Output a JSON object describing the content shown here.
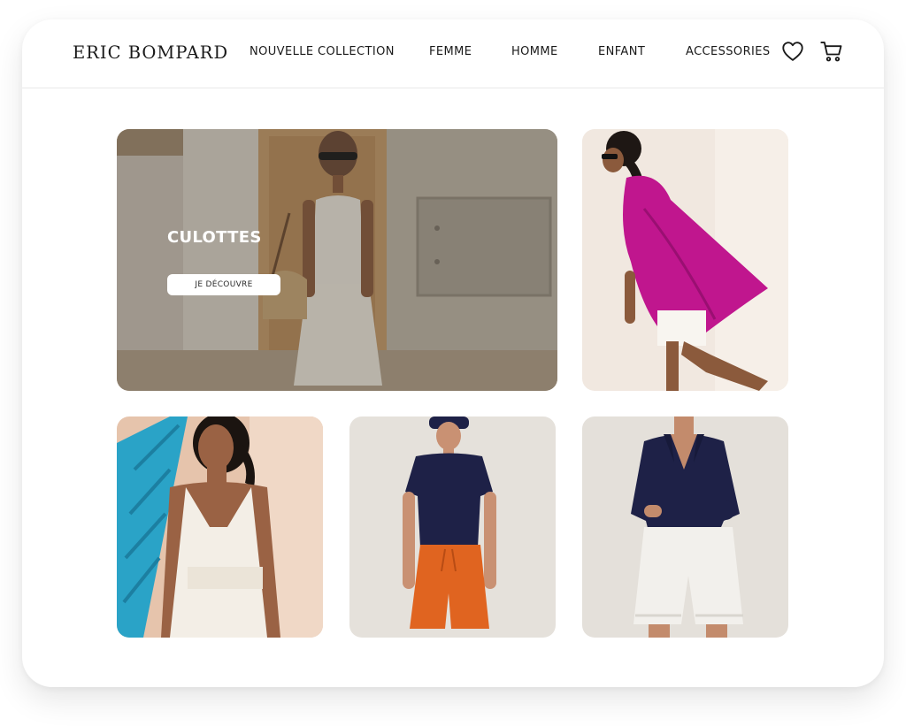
{
  "brand": {
    "logo_text": "ERIC BOMPARD"
  },
  "nav": {
    "items": [
      {
        "label": "NOUVELLE COLLECTION"
      },
      {
        "label": "FEMME"
      },
      {
        "label": "HOMME"
      },
      {
        "label": "ENFANT"
      },
      {
        "label": "ACCESSORIES"
      }
    ],
    "icons": {
      "wishlist": "heart-icon",
      "cart": "cart-icon"
    }
  },
  "hero": {
    "title": "CULOTTES",
    "cta_label": "JE DÉCOUVRE"
  },
  "tiles": [
    {
      "subject": "woman in magenta knit poncho"
    },
    {
      "subject": "woman in white knit tank dress"
    },
    {
      "subject": "woman in navy tee and orange shorts"
    },
    {
      "subject": "woman in navy polo and white shorts"
    }
  ],
  "colors": {
    "text": "#1a1a1a",
    "magenta": "#c0168e",
    "navy": "#1e2147",
    "orange": "#e06420",
    "turquoise": "#2aa3c7"
  }
}
